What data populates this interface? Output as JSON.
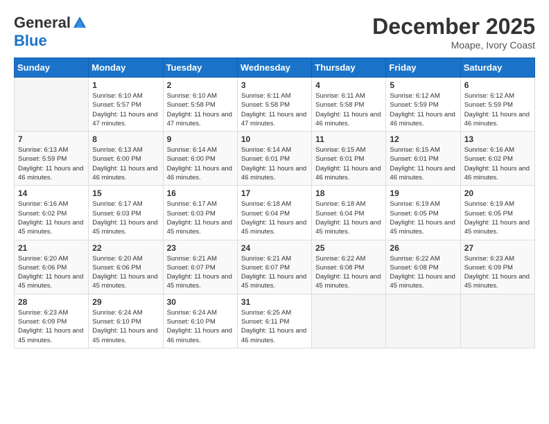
{
  "header": {
    "logo_line1": "General",
    "logo_line2": "Blue",
    "month": "December 2025",
    "location": "Moape, Ivory Coast"
  },
  "weekdays": [
    "Sunday",
    "Monday",
    "Tuesday",
    "Wednesday",
    "Thursday",
    "Friday",
    "Saturday"
  ],
  "weeks": [
    [
      {
        "day": "",
        "sunrise": "",
        "sunset": "",
        "daylight": ""
      },
      {
        "day": "1",
        "sunrise": "Sunrise: 6:10 AM",
        "sunset": "Sunset: 5:57 PM",
        "daylight": "Daylight: 11 hours and 47 minutes."
      },
      {
        "day": "2",
        "sunrise": "Sunrise: 6:10 AM",
        "sunset": "Sunset: 5:58 PM",
        "daylight": "Daylight: 11 hours and 47 minutes."
      },
      {
        "day": "3",
        "sunrise": "Sunrise: 6:11 AM",
        "sunset": "Sunset: 5:58 PM",
        "daylight": "Daylight: 11 hours and 47 minutes."
      },
      {
        "day": "4",
        "sunrise": "Sunrise: 6:11 AM",
        "sunset": "Sunset: 5:58 PM",
        "daylight": "Daylight: 11 hours and 46 minutes."
      },
      {
        "day": "5",
        "sunrise": "Sunrise: 6:12 AM",
        "sunset": "Sunset: 5:59 PM",
        "daylight": "Daylight: 11 hours and 46 minutes."
      },
      {
        "day": "6",
        "sunrise": "Sunrise: 6:12 AM",
        "sunset": "Sunset: 5:59 PM",
        "daylight": "Daylight: 11 hours and 46 minutes."
      }
    ],
    [
      {
        "day": "7",
        "sunrise": "Sunrise: 6:13 AM",
        "sunset": "Sunset: 5:59 PM",
        "daylight": "Daylight: 11 hours and 46 minutes."
      },
      {
        "day": "8",
        "sunrise": "Sunrise: 6:13 AM",
        "sunset": "Sunset: 6:00 PM",
        "daylight": "Daylight: 11 hours and 46 minutes."
      },
      {
        "day": "9",
        "sunrise": "Sunrise: 6:14 AM",
        "sunset": "Sunset: 6:00 PM",
        "daylight": "Daylight: 11 hours and 46 minutes."
      },
      {
        "day": "10",
        "sunrise": "Sunrise: 6:14 AM",
        "sunset": "Sunset: 6:01 PM",
        "daylight": "Daylight: 11 hours and 46 minutes."
      },
      {
        "day": "11",
        "sunrise": "Sunrise: 6:15 AM",
        "sunset": "Sunset: 6:01 PM",
        "daylight": "Daylight: 11 hours and 46 minutes."
      },
      {
        "day": "12",
        "sunrise": "Sunrise: 6:15 AM",
        "sunset": "Sunset: 6:01 PM",
        "daylight": "Daylight: 11 hours and 46 minutes."
      },
      {
        "day": "13",
        "sunrise": "Sunrise: 6:16 AM",
        "sunset": "Sunset: 6:02 PM",
        "daylight": "Daylight: 11 hours and 46 minutes."
      }
    ],
    [
      {
        "day": "14",
        "sunrise": "Sunrise: 6:16 AM",
        "sunset": "Sunset: 6:02 PM",
        "daylight": "Daylight: 11 hours and 45 minutes."
      },
      {
        "day": "15",
        "sunrise": "Sunrise: 6:17 AM",
        "sunset": "Sunset: 6:03 PM",
        "daylight": "Daylight: 11 hours and 45 minutes."
      },
      {
        "day": "16",
        "sunrise": "Sunrise: 6:17 AM",
        "sunset": "Sunset: 6:03 PM",
        "daylight": "Daylight: 11 hours and 45 minutes."
      },
      {
        "day": "17",
        "sunrise": "Sunrise: 6:18 AM",
        "sunset": "Sunset: 6:04 PM",
        "daylight": "Daylight: 11 hours and 45 minutes."
      },
      {
        "day": "18",
        "sunrise": "Sunrise: 6:18 AM",
        "sunset": "Sunset: 6:04 PM",
        "daylight": "Daylight: 11 hours and 45 minutes."
      },
      {
        "day": "19",
        "sunrise": "Sunrise: 6:19 AM",
        "sunset": "Sunset: 6:05 PM",
        "daylight": "Daylight: 11 hours and 45 minutes."
      },
      {
        "day": "20",
        "sunrise": "Sunrise: 6:19 AM",
        "sunset": "Sunset: 6:05 PM",
        "daylight": "Daylight: 11 hours and 45 minutes."
      }
    ],
    [
      {
        "day": "21",
        "sunrise": "Sunrise: 6:20 AM",
        "sunset": "Sunset: 6:06 PM",
        "daylight": "Daylight: 11 hours and 45 minutes."
      },
      {
        "day": "22",
        "sunrise": "Sunrise: 6:20 AM",
        "sunset": "Sunset: 6:06 PM",
        "daylight": "Daylight: 11 hours and 45 minutes."
      },
      {
        "day": "23",
        "sunrise": "Sunrise: 6:21 AM",
        "sunset": "Sunset: 6:07 PM",
        "daylight": "Daylight: 11 hours and 45 minutes."
      },
      {
        "day": "24",
        "sunrise": "Sunrise: 6:21 AM",
        "sunset": "Sunset: 6:07 PM",
        "daylight": "Daylight: 11 hours and 45 minutes."
      },
      {
        "day": "25",
        "sunrise": "Sunrise: 6:22 AM",
        "sunset": "Sunset: 6:08 PM",
        "daylight": "Daylight: 11 hours and 45 minutes."
      },
      {
        "day": "26",
        "sunrise": "Sunrise: 6:22 AM",
        "sunset": "Sunset: 6:08 PM",
        "daylight": "Daylight: 11 hours and 45 minutes."
      },
      {
        "day": "27",
        "sunrise": "Sunrise: 6:23 AM",
        "sunset": "Sunset: 6:09 PM",
        "daylight": "Daylight: 11 hours and 45 minutes."
      }
    ],
    [
      {
        "day": "28",
        "sunrise": "Sunrise: 6:23 AM",
        "sunset": "Sunset: 6:09 PM",
        "daylight": "Daylight: 11 hours and 45 minutes."
      },
      {
        "day": "29",
        "sunrise": "Sunrise: 6:24 AM",
        "sunset": "Sunset: 6:10 PM",
        "daylight": "Daylight: 11 hours and 45 minutes."
      },
      {
        "day": "30",
        "sunrise": "Sunrise: 6:24 AM",
        "sunset": "Sunset: 6:10 PM",
        "daylight": "Daylight: 11 hours and 46 minutes."
      },
      {
        "day": "31",
        "sunrise": "Sunrise: 6:25 AM",
        "sunset": "Sunset: 6:11 PM",
        "daylight": "Daylight: 11 hours and 46 minutes."
      },
      {
        "day": "",
        "sunrise": "",
        "sunset": "",
        "daylight": ""
      },
      {
        "day": "",
        "sunrise": "",
        "sunset": "",
        "daylight": ""
      },
      {
        "day": "",
        "sunrise": "",
        "sunset": "",
        "daylight": ""
      }
    ]
  ]
}
